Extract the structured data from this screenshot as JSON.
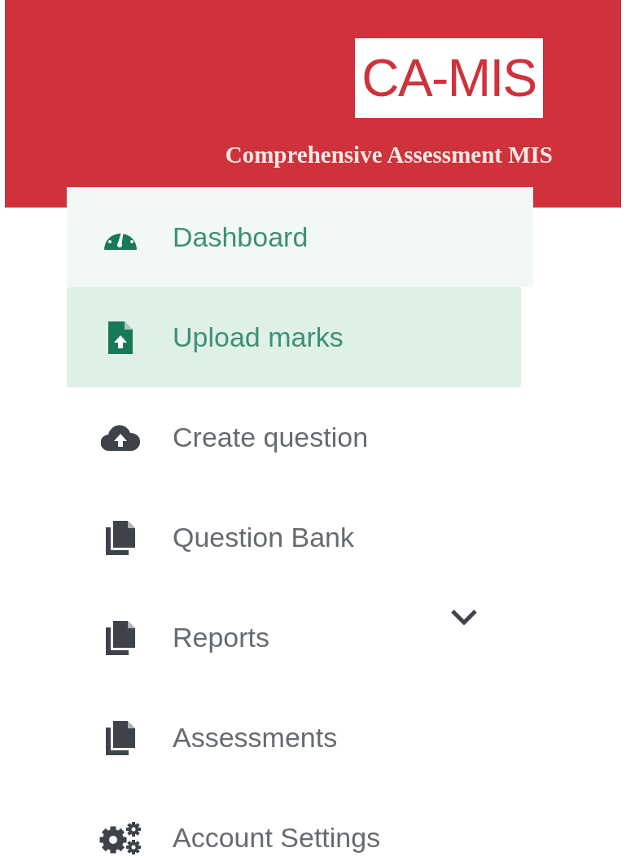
{
  "header": {
    "logo": "CA-MIS",
    "subtitle": "Comprehensive Assessment MIS"
  },
  "menu": [
    {
      "label": "Dashboard",
      "selected": false,
      "hovered": true,
      "kind": "link"
    },
    {
      "label": "Upload marks",
      "selected": true,
      "hovered": false,
      "kind": "link"
    },
    {
      "label": "Create question",
      "selected": false,
      "hovered": false,
      "kind": "link"
    },
    {
      "label": "Question Bank",
      "selected": false,
      "hovered": false,
      "kind": "link"
    },
    {
      "label": "Reports",
      "selected": false,
      "hovered": false,
      "kind": "group",
      "expanded": false
    },
    {
      "label": "Assessments",
      "selected": false,
      "hovered": false,
      "kind": "link"
    },
    {
      "label": "Account Settings",
      "selected": false,
      "hovered": false,
      "kind": "link"
    }
  ]
}
